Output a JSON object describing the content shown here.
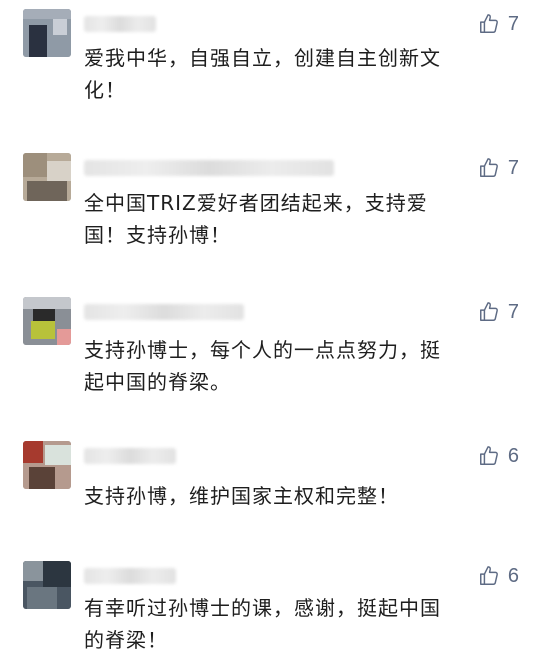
{
  "comments": [
    {
      "likes": "7",
      "text": "爱我中华，自强自立，创建自主创新文\n化！"
    },
    {
      "likes": "7",
      "text": "全中国TRIZ爱好者团结起来，支持爱\n国！支持孙博！"
    },
    {
      "likes": "7",
      "text": "支持孙博士，每个人的一点点努力，挺\n起中国的脊梁。"
    },
    {
      "likes": "6",
      "text": "支持孙博，维护国家主权和完整！"
    },
    {
      "likes": "6",
      "text": "有幸听过孙博士的课，感谢，挺起中国\n的脊梁！"
    }
  ],
  "colors": {
    "like": "#5e6b84",
    "text": "#1e1e1e",
    "background": "#ffffff"
  },
  "icons": {
    "like": "thumbs-up-icon"
  }
}
